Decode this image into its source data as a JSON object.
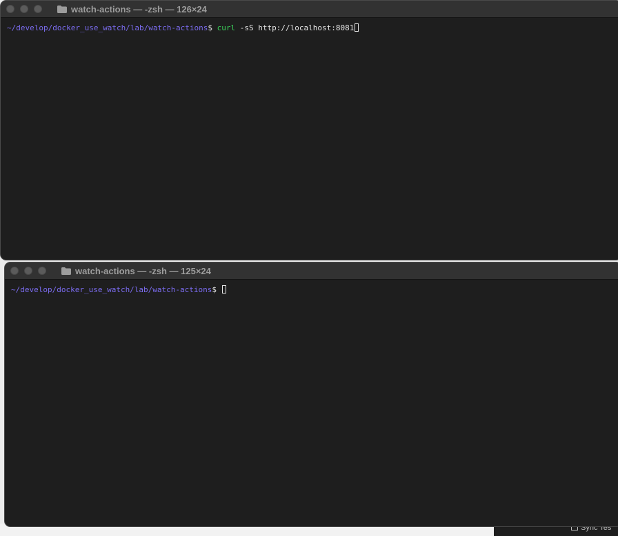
{
  "background": {
    "partial_label": "Sync Tes"
  },
  "windows": [
    {
      "title": "watch-actions — -zsh — 126×24",
      "prompt_path": "~/develop/docker_use_watch/lab/watch-actions",
      "prompt_symbol": "$",
      "command": "curl",
      "arguments": "-sS http://localhost:8081"
    },
    {
      "title": "watch-actions — -zsh — 125×24",
      "prompt_path": "~/develop/docker_use_watch/lab/watch-actions",
      "prompt_symbol": "$"
    }
  ],
  "colors": {
    "terminal_bg": "#1e1e1e",
    "titlebar_bg": "#323232",
    "prompt_path": "#7b6cf0",
    "command": "#3bd15a",
    "text": "#e6e6e6"
  }
}
